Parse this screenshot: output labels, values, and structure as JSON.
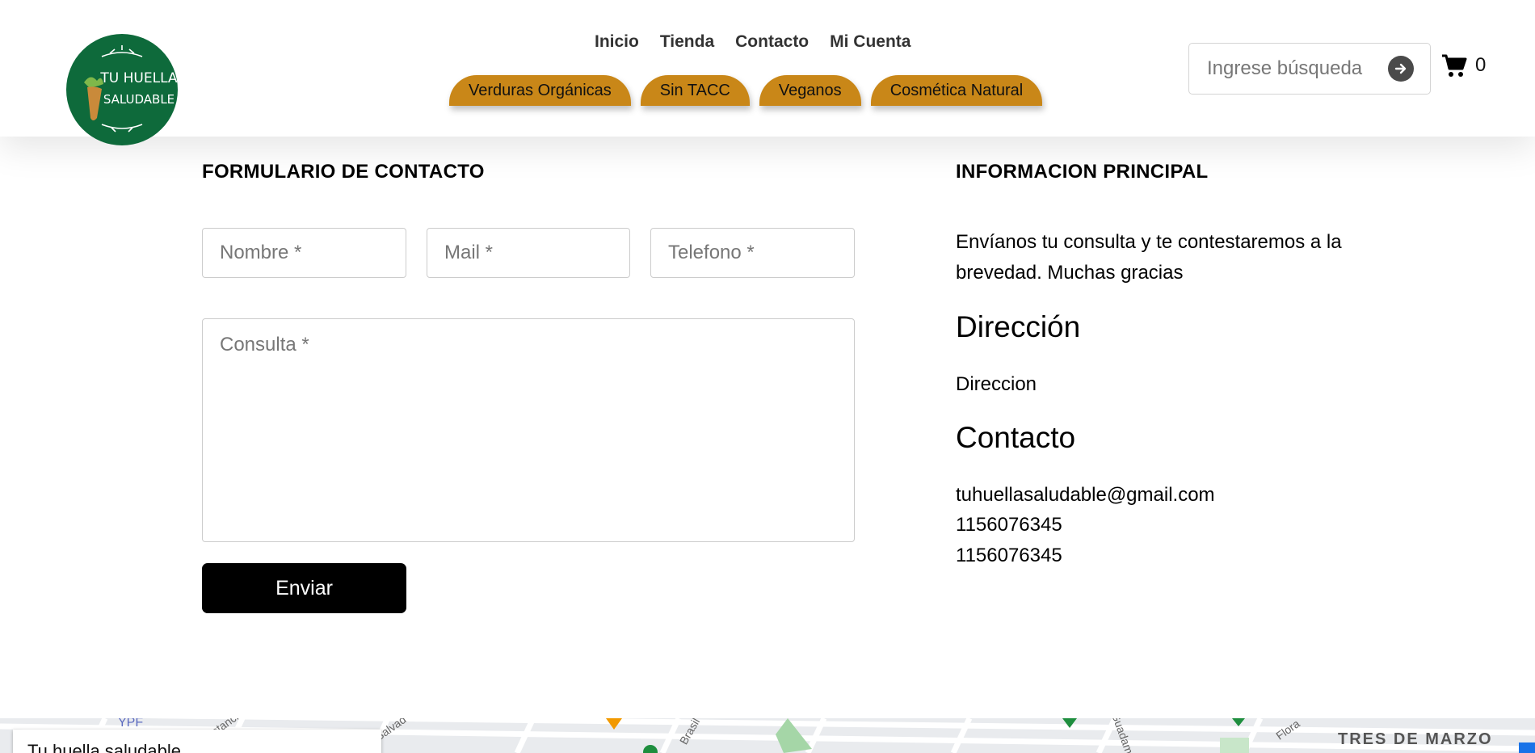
{
  "brand": {
    "logo_line1": "TU HUELLA",
    "logo_line2": "SALUDABLE"
  },
  "nav": {
    "items": [
      "Inicio",
      "Tienda",
      "Contacto",
      "Mi Cuenta"
    ]
  },
  "categories": [
    "Verduras Orgánicas",
    "Sin TACC",
    "Veganos",
    "Cosmética Natural"
  ],
  "search": {
    "placeholder": "Ingrese búsqueda"
  },
  "cart": {
    "count": "0"
  },
  "form": {
    "title": "FORMULARIO DE CONTACTO",
    "name_placeholder": "Nombre *",
    "mail_placeholder": "Mail *",
    "phone_placeholder": "Telefono *",
    "message_placeholder": "Consulta *",
    "submit_label": "Enviar"
  },
  "info": {
    "title": "INFORMACION PRINCIPAL",
    "text": "Envíanos tu consulta y te contestaremos a la brevedad. Muchas gracias",
    "address_heading": "Dirección",
    "address_value": "Direccion",
    "contact_heading": "Contacto",
    "email": "tuhuellasaludable@gmail.com",
    "phone1": "1156076345",
    "phone2": "1156076345"
  },
  "map": {
    "card_title": "Tu huella saludable",
    "district": "TRES DE MARZO",
    "labels": [
      "YPF",
      "Constancia",
      "Salvad",
      "Brasil",
      "Guadame",
      "Flora"
    ]
  },
  "colors": {
    "brand_green": "#0e6a3b",
    "category_tab": "#c98718",
    "button": "#000000"
  }
}
